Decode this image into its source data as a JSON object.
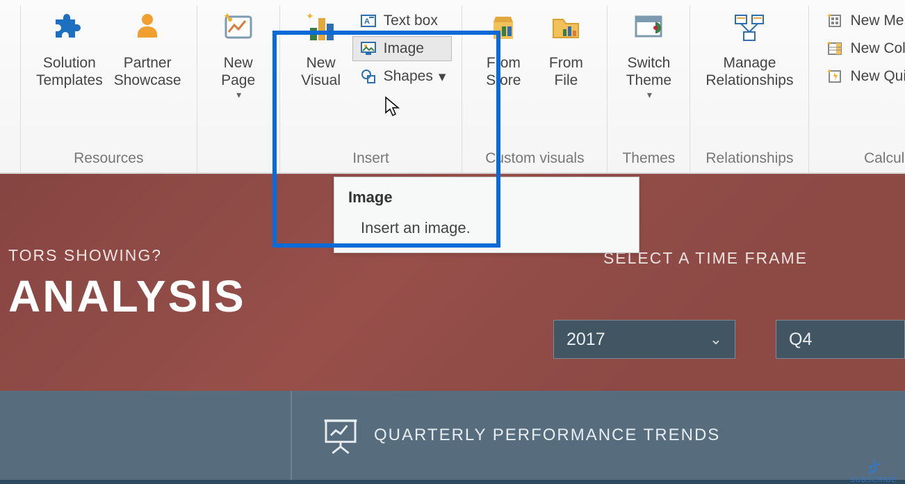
{
  "ribbon": {
    "groups": {
      "resources": {
        "label": "Resources",
        "solution_templates": "Solution\nTemplates",
        "partner_showcase": "Partner\nShowcase"
      },
      "pages": {
        "new_page": "New\nPage"
      },
      "insert": {
        "label": "Insert",
        "new_visual": "New\nVisual",
        "text_box": "Text box",
        "image": "Image",
        "shapes": "Shapes"
      },
      "custom_visuals": {
        "label": "Custom visuals",
        "from_store": "From\nStore",
        "from_file": "From\nFile"
      },
      "themes": {
        "label": "Themes",
        "switch_theme": "Switch\nTheme"
      },
      "relationships": {
        "label": "Relationships",
        "manage": "Manage\nRelationships"
      },
      "calculations": {
        "label": "Calcula",
        "new_me": "New Me",
        "new_col": "New Col",
        "new_qui": "New Qui"
      }
    }
  },
  "tooltip": {
    "title": "Image",
    "body": "Insert an image."
  },
  "canvas": {
    "subheading": "TORS SHOWING?",
    "title": "ANALYSIS",
    "select_label": "SELECT A TIME FRAME",
    "year_value": "2017",
    "quarter_value": "Q4",
    "panel_b": "QUARTERLY PERFORMANCE TRENDS"
  },
  "subscribe": "SUBSCRIBE"
}
